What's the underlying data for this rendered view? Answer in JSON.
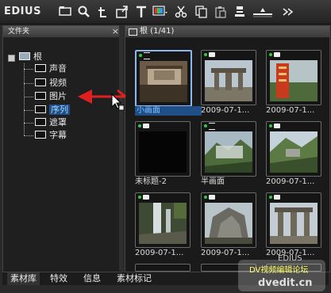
{
  "toolbar": {
    "brand": "EDIUS",
    "icons": [
      "folder-icon",
      "search-icon",
      "t-up-icon",
      "import-icon",
      "title-icon",
      "monitor-icon",
      "cut-icon",
      "copy-icon",
      "paste-icon",
      "properties-icon",
      "timeline-icon",
      "more-icon"
    ]
  },
  "folder_panel": {
    "title": "文件夹",
    "close": "×",
    "root": "根",
    "children": [
      "声音",
      "视频",
      "图片",
      "序列",
      "遮罩",
      "字幕"
    ],
    "selected_index": 3
  },
  "bin": {
    "header": "根 (1/41)",
    "clips": [
      {
        "label": "小画面",
        "type": "sequence",
        "selected": true
      },
      {
        "label": "2009-07-1...",
        "type": "video",
        "selected": false
      },
      {
        "label": "2009-07-1...",
        "type": "video",
        "selected": false
      },
      {
        "label": "未标题-2",
        "type": "video",
        "selected": false
      },
      {
        "label": "半画面",
        "type": "sequence",
        "selected": false
      },
      {
        "label": "2009-07-1...",
        "type": "video",
        "selected": false
      },
      {
        "label": "2009-07-1...",
        "type": "video",
        "selected": false
      },
      {
        "label": "2009-07-1...",
        "type": "video",
        "selected": false
      },
      {
        "label": "2009-07-1...",
        "type": "video",
        "selected": false
      }
    ]
  },
  "tabs": [
    "素材库",
    "特效",
    "信息",
    "素材标记"
  ],
  "watermark": {
    "line1": "DV视频编辑论坛",
    "line2": "dvedit.cn",
    "overlay": "EDIUS"
  },
  "colors": {
    "selection": "#1f4f86",
    "selected_text": "#7fc0ff",
    "arrow": "#e02020",
    "status_dot": "#2ecc40"
  }
}
